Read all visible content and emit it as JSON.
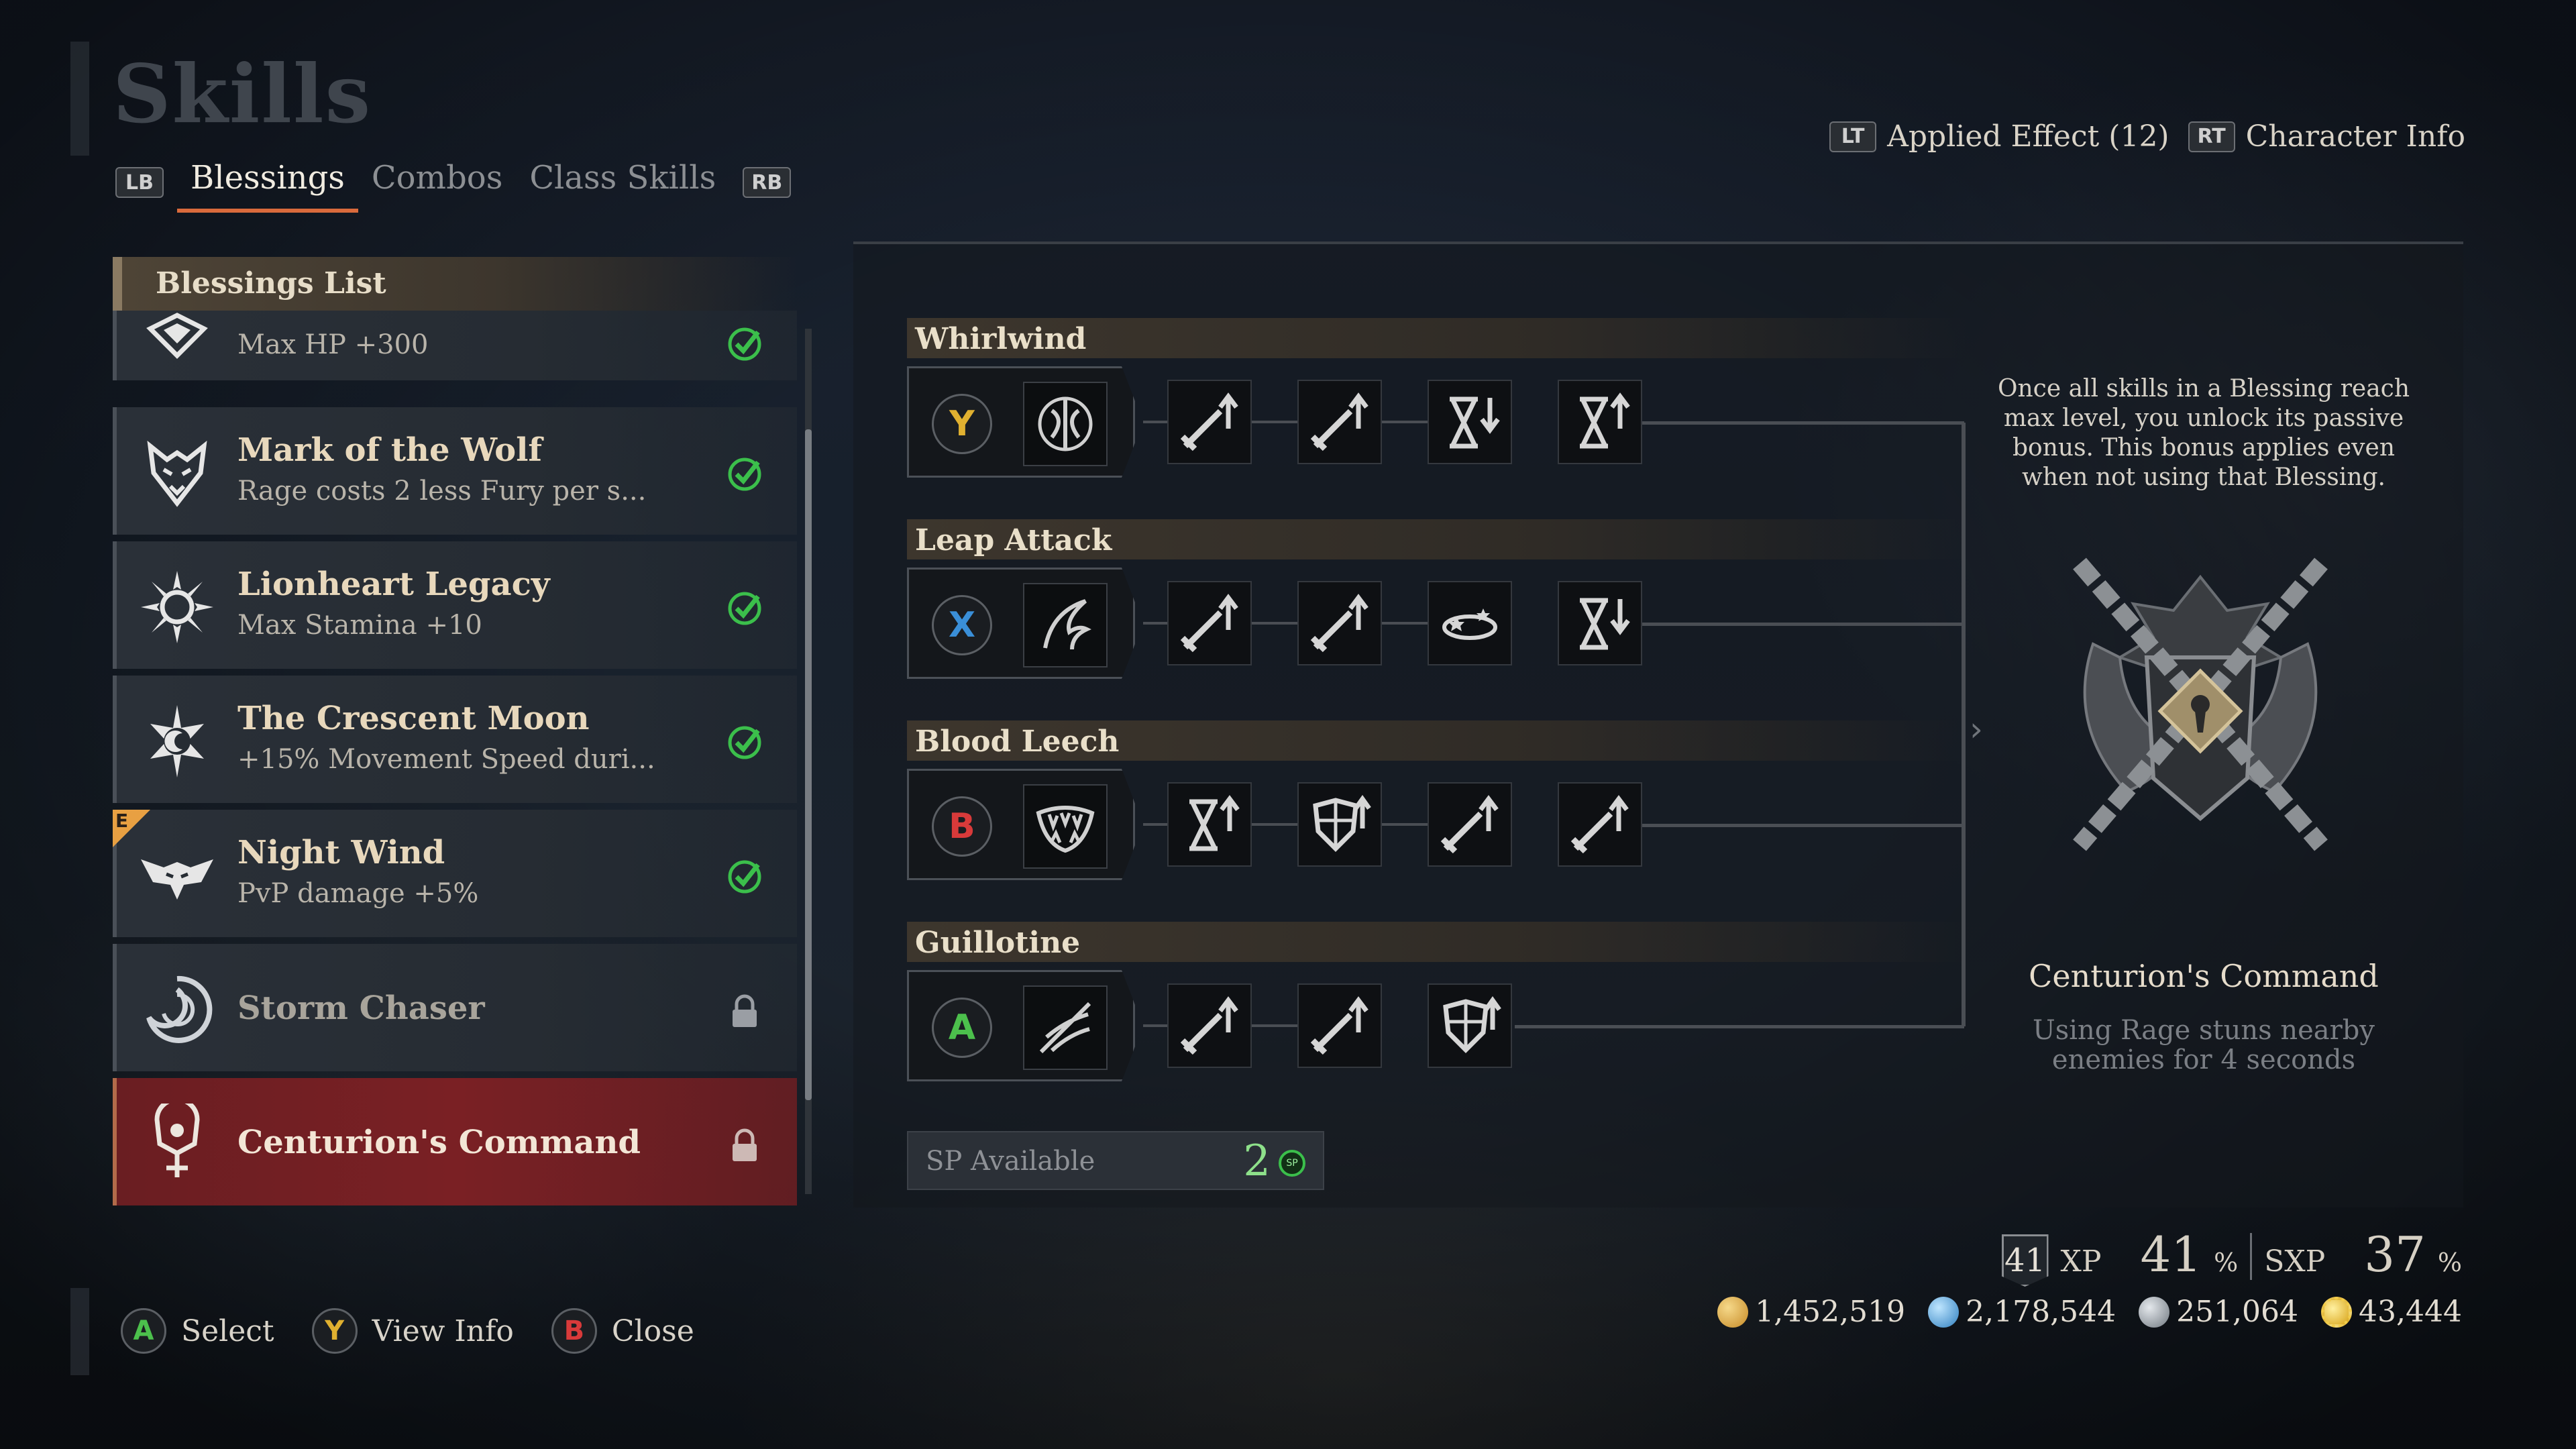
{
  "header": {
    "title": "Skills",
    "lb": "LB",
    "rb": "RB",
    "tabs": [
      "Blessings",
      "Combos",
      "Class Skills"
    ]
  },
  "top_right": {
    "lt": "LT",
    "applied_effect": "Applied Effect (12)",
    "rt": "RT",
    "character_info": "Character Info"
  },
  "list": {
    "header": "Blessings List",
    "items": [
      {
        "name": "",
        "desc": "Max HP +300",
        "status": "acquired",
        "icon": "crown-emblem-icon"
      },
      {
        "name": "Mark of the Wolf",
        "desc": "Rage costs 2 less Fury per s...",
        "status": "acquired",
        "icon": "wolf-emblem-icon"
      },
      {
        "name": "Lionheart Legacy",
        "desc": "Max Stamina +10",
        "status": "acquired",
        "icon": "sun-emblem-icon"
      },
      {
        "name": "The Crescent Moon",
        "desc": "+15% Movement Speed duri...",
        "status": "acquired",
        "icon": "moon-emblem-icon"
      },
      {
        "name": "Night Wind",
        "desc": "PvP damage +5%",
        "status": "acquired",
        "icon": "bat-emblem-icon",
        "badge": "E"
      },
      {
        "name": "Storm Chaser",
        "desc": "",
        "status": "locked",
        "icon": "storm-emblem-icon"
      },
      {
        "name": "Centurion's Command",
        "desc": "",
        "status": "locked",
        "icon": "centurion-emblem-icon",
        "selected": true
      }
    ]
  },
  "skills": [
    {
      "name": "Whirlwind",
      "button": "Y",
      "button_color": "#e0b030",
      "icon": "whirlwind-axe-icon",
      "nodes": [
        "sword-up-icon",
        "sword-up-icon",
        "hourglass-down-icon",
        "hourglass-up-icon"
      ]
    },
    {
      "name": "Leap Attack",
      "button": "X",
      "button_color": "#3a8fd8",
      "icon": "leap-claw-icon",
      "nodes": [
        "sword-up-icon",
        "sword-up-icon",
        "stun-stars-icon",
        "hourglass-down-icon"
      ]
    },
    {
      "name": "Blood Leech",
      "button": "B",
      "button_color": "#d83a3a",
      "icon": "fangs-icon",
      "nodes": [
        "hourglass-up-icon",
        "shield-up-icon",
        "sword-up-icon",
        "sword-up-icon"
      ]
    },
    {
      "name": "Guillotine",
      "button": "A",
      "button_color": "#4cc04c",
      "icon": "guillotine-slash-icon",
      "nodes": [
        "sword-up-icon",
        "sword-up-icon",
        "shield-up-icon"
      ]
    }
  ],
  "sp": {
    "label": "SP Available",
    "value": "2",
    "icon_text": "SP"
  },
  "bonus": {
    "info": "Once all skills in a Blessing reach max level, you unlock its passive bonus. This bonus applies even when not using that Blessing.",
    "name": "Centurion's Command",
    "desc": "Using Rage stuns nearby enemies for 4 seconds"
  },
  "xp": {
    "level": "41",
    "xp_label": "XP",
    "xp_value": "41",
    "xp_pct": "%",
    "sxp_label": "SXP",
    "sxp_value": "37",
    "sxp_pct": "%"
  },
  "currency": [
    {
      "value": "1,452,519",
      "color": "#d8a23a",
      "icon": "gold-coin-icon"
    },
    {
      "value": "2,178,544",
      "color": "#4aa0d8",
      "icon": "blue-shard-icon"
    },
    {
      "value": "251,064",
      "color": "#9aa4ae",
      "icon": "silver-ore-icon"
    },
    {
      "value": "43,444",
      "color": "#e8c030",
      "icon": "gear-token-icon"
    }
  ],
  "footer": [
    {
      "button": "A",
      "label": "Select",
      "color": "#4cc04c"
    },
    {
      "button": "Y",
      "label": "View Info",
      "color": "#e0b030"
    },
    {
      "button": "B",
      "label": "Close",
      "color": "#d83a3a"
    }
  ],
  "colors": {
    "accent": "#d96a3c",
    "selected_row": "#7a2024",
    "acquired_check": "#3bbf4b"
  }
}
